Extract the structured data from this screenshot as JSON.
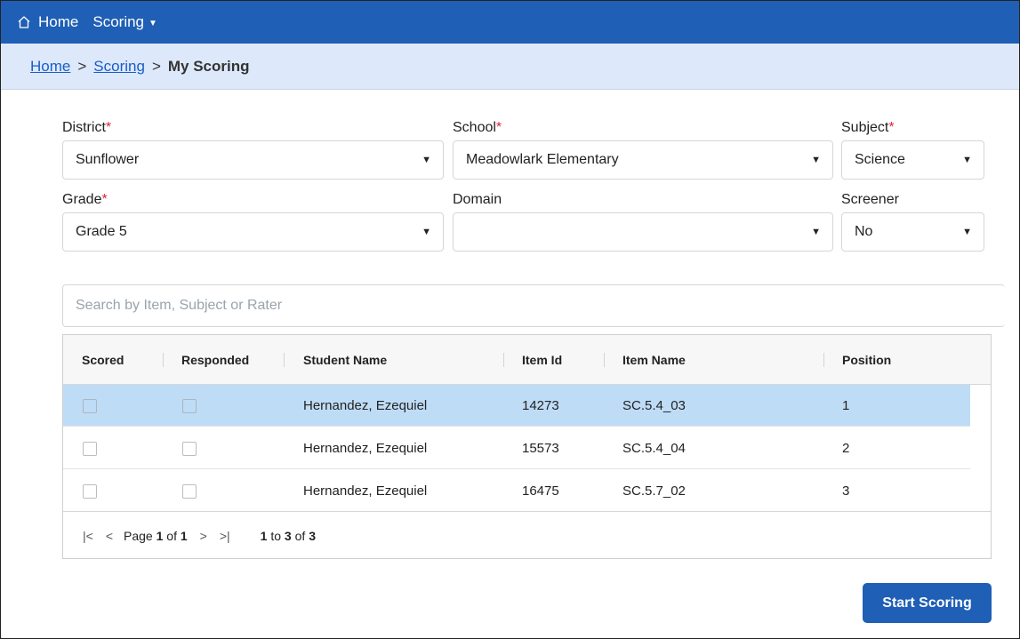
{
  "nav": {
    "home_label": "Home",
    "scoring_label": "Scoring"
  },
  "breadcrumb": {
    "home": "Home",
    "scoring": "Scoring",
    "current": "My Scoring",
    "separator": ">"
  },
  "filters": {
    "district": {
      "label": "District",
      "required": "*",
      "value": "Sunflower"
    },
    "school": {
      "label": "School",
      "required": "*",
      "value": "Meadowlark Elementary"
    },
    "subject": {
      "label": "Subject",
      "required": "*",
      "value": "Science"
    },
    "grade": {
      "label": "Grade",
      "required": "*",
      "value": "Grade 5"
    },
    "domain": {
      "label": "Domain",
      "value": ""
    },
    "screener": {
      "label": "Screener",
      "value": "No"
    }
  },
  "search": {
    "placeholder": "Search by Item, Subject or Rater",
    "value": ""
  },
  "table": {
    "columns": [
      "Scored",
      "Responded",
      "Student Name",
      "Item Id",
      "Item Name",
      "Position"
    ],
    "rows": [
      {
        "scored": false,
        "responded": false,
        "student_name": "Hernandez, Ezequiel",
        "item_id": "14273",
        "item_name": "SC.5.4_03",
        "position": "1",
        "selected": true
      },
      {
        "scored": false,
        "responded": false,
        "student_name": "Hernandez, Ezequiel",
        "item_id": "15573",
        "item_name": "SC.5.4_04",
        "position": "2",
        "selected": false
      },
      {
        "scored": false,
        "responded": false,
        "student_name": "Hernandez, Ezequiel",
        "item_id": "16475",
        "item_name": "SC.5.7_02",
        "position": "3",
        "selected": false
      }
    ],
    "pagination": {
      "page_word": "Page",
      "current_page": "1",
      "of_word": "of",
      "total_pages": "1",
      "range_start": "1",
      "to_word": "to",
      "range_end": "3",
      "total_rows": "3"
    }
  },
  "actions": {
    "start_scoring": "Start Scoring"
  },
  "colors": {
    "brand": "#1f5fb5",
    "breadcrumb_bg": "#dde9fb",
    "selected_row": "#bfdcf7",
    "required": "#d9263d"
  },
  "icons": {
    "home": "home-icon",
    "caret": "caret-down-icon",
    "select_arrow": "caret-down-icon",
    "first_page": "first-page-icon",
    "prev_page": "prev-page-icon",
    "next_page": "next-page-icon",
    "last_page": "last-page-icon"
  }
}
